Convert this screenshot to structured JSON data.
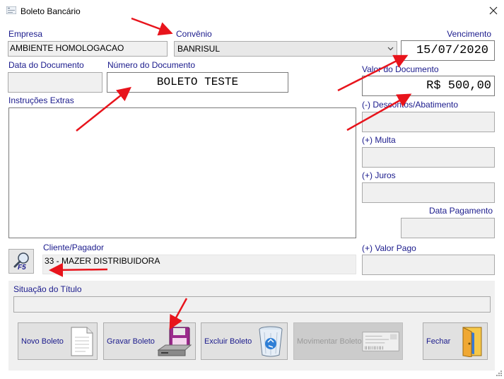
{
  "window": {
    "title": "Boleto Bancário"
  },
  "labels": {
    "empresa": "Empresa",
    "convenio": "Convênio",
    "vencimento": "Vencimento",
    "data_documento": "Data do Documento",
    "numero_documento": "Número do Documento",
    "valor_documento": "Valor do Documento",
    "instrucoes": "Instruções Extras",
    "descontos": "(-) Descontos/Abatimento",
    "multa": "(+) Multa",
    "juros": "(+) Juros",
    "data_pagamento": "Data Pagamento",
    "cliente": "Cliente/Pagador",
    "valor_pago": "(+) Valor Pago",
    "situacao": "Situação do Título"
  },
  "fields": {
    "empresa": "AMBIENTE HOMOLOGACAO",
    "convenio": "BANRISUL",
    "vencimento": "15/07/2020",
    "data_documento": "",
    "numero_documento": "BOLETO TESTE",
    "valor_documento": "R$ 500,00",
    "instrucoes": "",
    "descontos": "",
    "multa": "",
    "juros": "",
    "data_pagamento": "",
    "cliente": "33 - MAZER DISTRIBUIDORA",
    "valor_pago": "",
    "situacao": ""
  },
  "search_button": {
    "key": "F5"
  },
  "buttons": {
    "novo": "Novo Boleto",
    "gravar": "Gravar Boleto",
    "excluir": "Excluir Boleto",
    "movimentar": "Movimentar Boleto",
    "fechar": "Fechar"
  },
  "colors": {
    "label": "#1a1a8c",
    "arrow": "#e8141c",
    "panel": "#f0f0f0"
  }
}
